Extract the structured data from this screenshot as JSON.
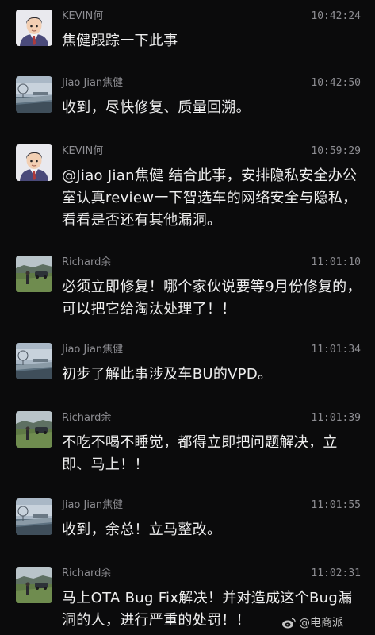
{
  "messages": [
    {
      "sender": "KEVIN何",
      "time": "10:42:24",
      "avatar": "kevin-cartoon-avatar",
      "text": "焦健跟踪一下此事"
    },
    {
      "sender": "Jiao Jian焦健",
      "time": "10:42:50",
      "avatar": "waterfront-photo-avatar",
      "text": "收到，尽快修复、质量回溯。"
    },
    {
      "sender": "KEVIN何",
      "time": "10:59:29",
      "avatar": "kevin-cartoon-avatar",
      "text": "@Jiao Jian焦健 结合此事，安排隐私安全办公室认真review一下智选车的网络安全与隐私，看看是否还有其他漏洞。"
    },
    {
      "sender": "Richard余",
      "time": "11:01:10",
      "avatar": "field-photo-avatar",
      "text": "必须立即修复！哪个家伙说要等9月份修复的，可以把它给淘汰处理了！！"
    },
    {
      "sender": "Jiao Jian焦健",
      "time": "11:01:34",
      "avatar": "waterfront-photo-avatar",
      "text": "初步了解此事涉及车BU的VPD。"
    },
    {
      "sender": "Richard余",
      "time": "11:01:39",
      "avatar": "field-photo-avatar",
      "text": "不吃不喝不睡觉，都得立即把问题解决，立即、马上！！"
    },
    {
      "sender": "Jiao Jian焦健",
      "time": "11:01:55",
      "avatar": "waterfront-photo-avatar",
      "text": "收到，余总！立马整改。"
    },
    {
      "sender": "Richard余",
      "time": "11:02:31",
      "avatar": "field-photo-avatar",
      "text": "马上OTA Bug Fix解决！并对造成这个Bug漏洞的人，进行严重的处罚！！"
    }
  ],
  "watermark": {
    "text": "@电商派",
    "icon": "weibo-logo-icon"
  },
  "colors": {
    "background": "#0b0b0c",
    "message_text": "#eeeeee",
    "meta_text": "#8d8d92"
  }
}
